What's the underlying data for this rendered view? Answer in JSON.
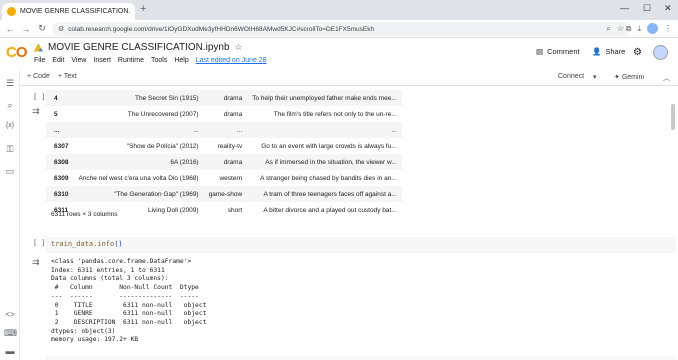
{
  "browser": {
    "tab_title": "MOVIE GENRE CLASSIFICATION.",
    "url": "colab.research.google.com/drive/1iOyGDXudMe3yfHHDn6WOIH68AMwd5KJC#scrollTo=DE1FX5musEkh"
  },
  "notebook": {
    "title": "MOVIE GENRE CLASSIFICATION.ipynb",
    "menus": [
      "File",
      "Edit",
      "View",
      "Insert",
      "Runtime",
      "Tools",
      "Help"
    ],
    "last_edited": "Last edited on June 28",
    "comment_label": "Comment",
    "share_label": "Share"
  },
  "toolbar": {
    "add_code": "+ Code",
    "add_text": "+ Text",
    "connect": "Connect",
    "gemini": "Gemini"
  },
  "dataframe": {
    "rows": [
      {
        "idx": "4",
        "title": "The Secret Sin (1915)",
        "genre": "drama",
        "desc": "To help their unemployed father make ends mee..."
      },
      {
        "idx": "5",
        "title": "The Unrecovered (2007)",
        "genre": "drama",
        "desc": "The film's title refers not only to the un-re..."
      },
      {
        "idx": "...",
        "title": "...",
        "genre": "...",
        "desc": "..."
      },
      {
        "idx": "6307",
        "title": "\"Show de Polícia\" (2012)",
        "genre": "reality-tv",
        "desc": "Go to an event with large crowds is always fu..."
      },
      {
        "idx": "6308",
        "title": "6A (2016)",
        "genre": "drama",
        "desc": "As if immersed in the situation, the viewer w..."
      },
      {
        "idx": "6309",
        "title": "Anche nel west c'era una volta Dio (1968)",
        "genre": "western",
        "desc": "A stranger being chased by bandits dies in an..."
      },
      {
        "idx": "6310",
        "title": "\"The Generation Gap\" (1969)",
        "genre": "game-show",
        "desc": "A tram of three teenagers faces off against a..."
      },
      {
        "idx": "6311",
        "title": "Living Doll (2009)",
        "genre": "short",
        "desc": "A bitter divorce and a played out custody bat..."
      }
    ],
    "shape": "6311 rows × 3 columns"
  },
  "cell": {
    "run_label": "[ ]",
    "code_fn": "train_data.info",
    "code_paren": "()"
  },
  "info_output": "<class 'pandas.core.frame.DataFrame'>\nIndex: 6311 entries, 1 to 6311\nData columns (total 3 columns):\n #   Column       Non-Null Count  Dtype \n---  ------       --------------  ----- \n 0    TITLE        6311 non-null   object\n 1    GENRE        6311 non-null   object\n 2    DESCRIPTION  6311 non-null   object\ndtypes: object(3)\nmemory usage: 197.2+ KB"
}
